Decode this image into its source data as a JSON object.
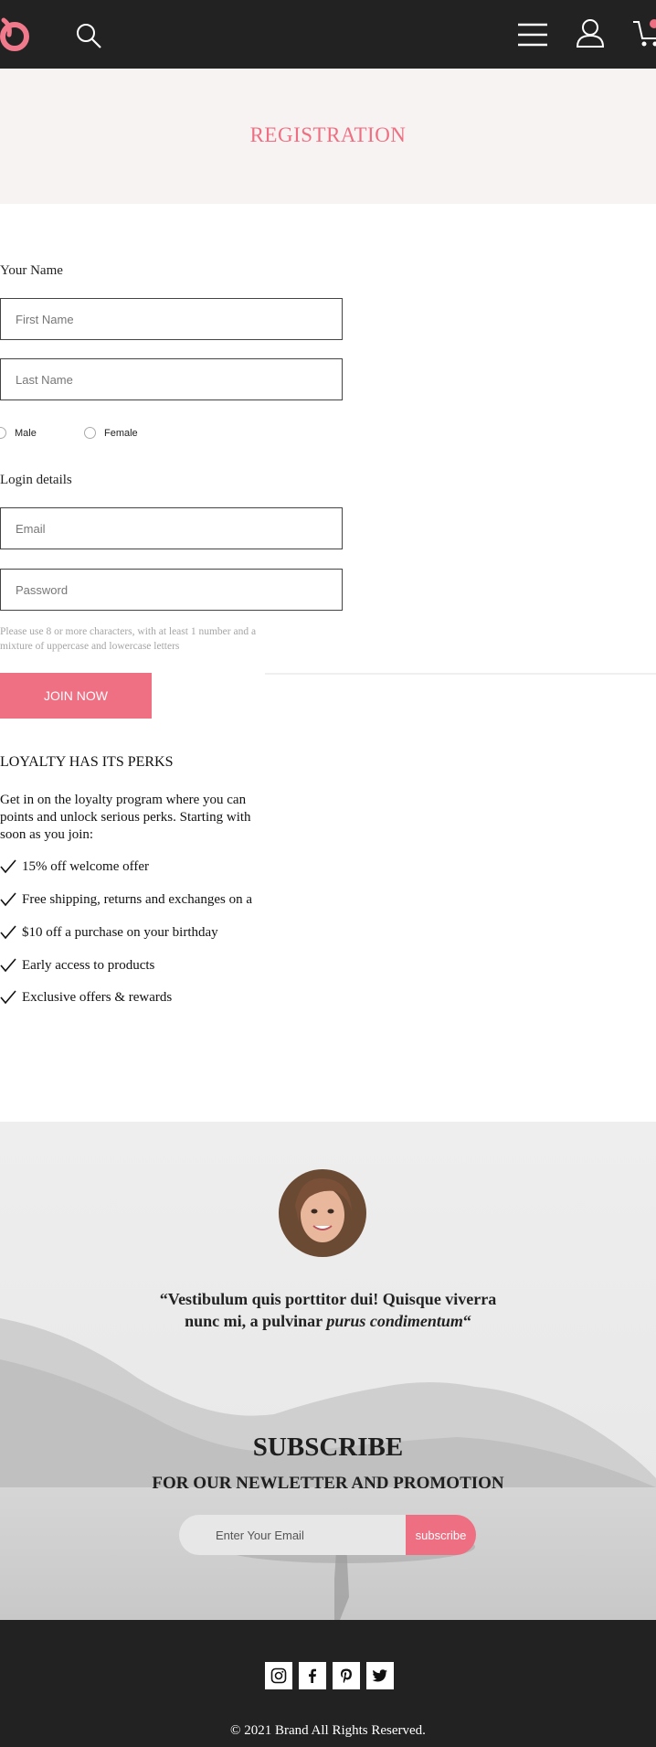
{
  "header": {
    "logo_icon": "brand-logo-icon",
    "icons": [
      "search-icon",
      "hamburger-menu-icon",
      "user-icon",
      "cart-icon"
    ],
    "accent_color": "#ef6f82"
  },
  "hero": {
    "title": "REGISTRATION"
  },
  "form": {
    "name_section_label": "Your Name",
    "first_name_placeholder": "First Name",
    "last_name_placeholder": "Last Name",
    "gender_options": [
      "Male",
      "Female"
    ],
    "login_section_label": "Login details",
    "email_placeholder": "Email",
    "password_placeholder": "Password",
    "password_hint_line1": "Please use 8 or more characters, with at least 1 number and a",
    "password_hint_line2": "mixture of uppercase and lowercase letters",
    "submit_label": "JOIN NOW"
  },
  "perks": {
    "title": "LOYALTY HAS ITS PERKS",
    "intro_line1": "Get in on the loyalty program where you can",
    "intro_line2": "points and unlock serious perks. Starting with",
    "intro_line3": "soon as you join:",
    "items": [
      "15% off welcome offer",
      "Free shipping, returns and exchanges on a",
      "$10 off a purchase on your birthday",
      "Early access to products",
      "Exclusive offers & rewards"
    ]
  },
  "testimonial": {
    "quote_part1": "“Vestibulum quis porttitor dui! Quisque viverra nunc mi, a pulvinar ",
    "quote_emphasis": "purus condimentum",
    "quote_close": "“"
  },
  "subscribe": {
    "title": "SUBSCRIBE",
    "subtitle": "FOR OUR NEWLETTER AND PROMOTION",
    "email_placeholder": "Enter Your Email",
    "button_label": "subscribe"
  },
  "footer": {
    "social_icons": [
      "instagram-icon",
      "facebook-icon",
      "pinterest-icon",
      "twitter-icon"
    ],
    "copyright": "© 2021 Brand All Rights Reserved."
  }
}
